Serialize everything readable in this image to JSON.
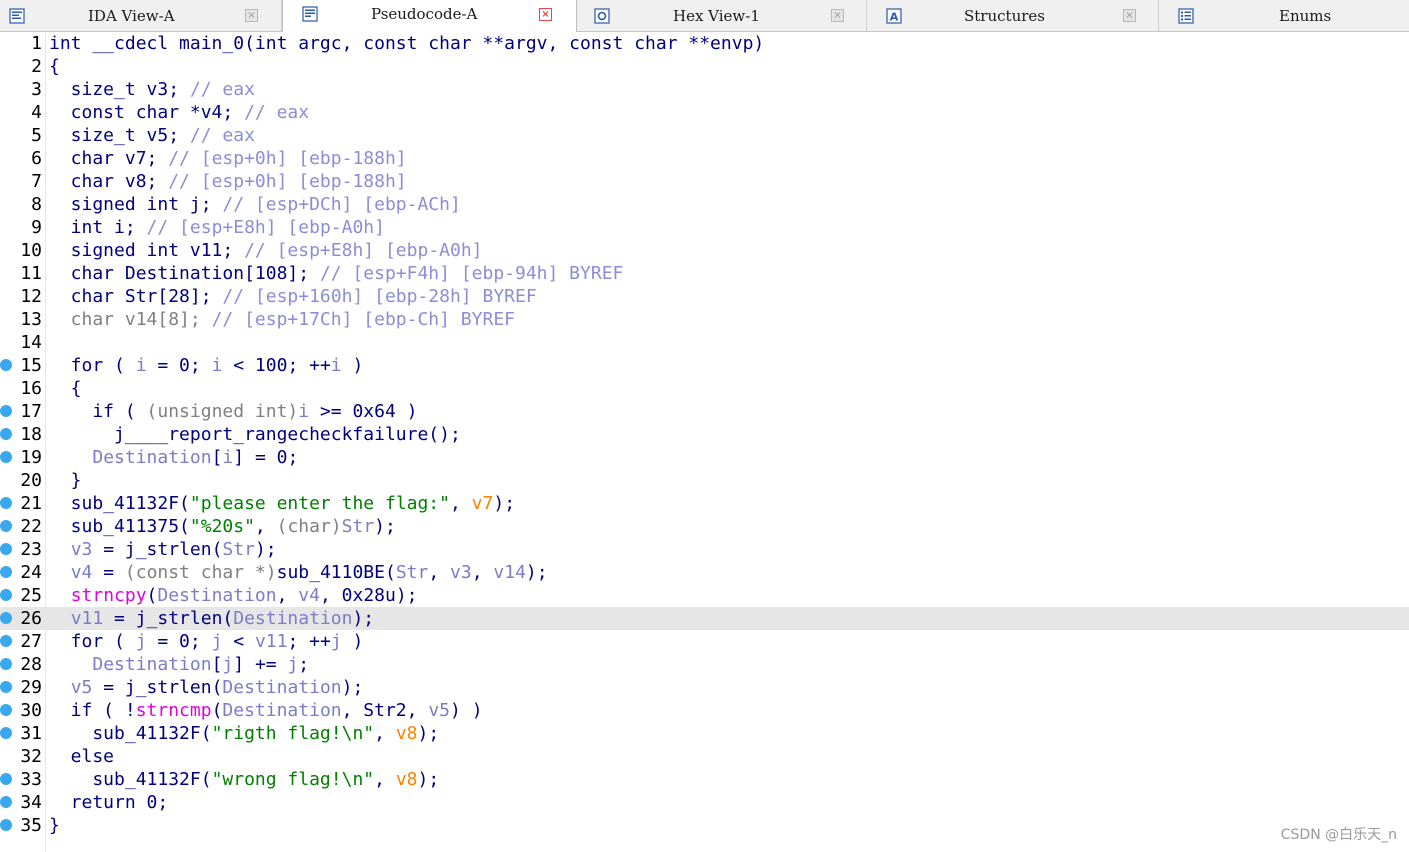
{
  "tabs": [
    {
      "label": "IDA View-A",
      "icon": "graph-view-icon",
      "active": false
    },
    {
      "label": "Pseudocode-A",
      "icon": "pseudocode-icon",
      "active": true
    },
    {
      "label": "Hex View-1",
      "icon": "hex-view-icon",
      "active": false
    },
    {
      "label": "Structures",
      "icon": "structures-icon",
      "active": false
    },
    {
      "label": "Enums",
      "icon": "enums-icon",
      "active": false
    }
  ],
  "close_glyph": "×",
  "current_line": 26,
  "breakpoint_lines": [
    15,
    17,
    18,
    19,
    21,
    22,
    23,
    24,
    25,
    26,
    27,
    28,
    29,
    30,
    31,
    33,
    34,
    35
  ],
  "code": [
    {
      "n": "1",
      "tokens": [
        [
          "ok",
          "int __cdecl main_0(int argc, const char **argv, const char **envp)"
        ]
      ]
    },
    {
      "n": "2",
      "tokens": [
        [
          "ok",
          "{"
        ]
      ]
    },
    {
      "n": "3",
      "tokens": [
        [
          "ok",
          "  size_t v3; "
        ],
        [
          "cm",
          "// eax"
        ]
      ]
    },
    {
      "n": "4",
      "tokens": [
        [
          "ok",
          "  const char *v4; "
        ],
        [
          "cm",
          "// eax"
        ]
      ]
    },
    {
      "n": "5",
      "tokens": [
        [
          "ok",
          "  size_t v5; "
        ],
        [
          "cm",
          "// eax"
        ]
      ]
    },
    {
      "n": "6",
      "tokens": [
        [
          "ok",
          "  char v7; "
        ],
        [
          "cm",
          "// [esp+0h] [ebp-188h]"
        ]
      ]
    },
    {
      "n": "7",
      "tokens": [
        [
          "ok",
          "  char v8; "
        ],
        [
          "cm",
          "// [esp+0h] [ebp-188h]"
        ]
      ]
    },
    {
      "n": "8",
      "tokens": [
        [
          "ok",
          "  signed int j; "
        ],
        [
          "cm",
          "// [esp+DCh] [ebp-ACh]"
        ]
      ]
    },
    {
      "n": "9",
      "tokens": [
        [
          "ok",
          "  int i; "
        ],
        [
          "cm",
          "// [esp+E8h] [ebp-A0h]"
        ]
      ]
    },
    {
      "n": "10",
      "tokens": [
        [
          "ok",
          "  signed int v11; "
        ],
        [
          "cm",
          "// [esp+E8h] [ebp-A0h]"
        ]
      ]
    },
    {
      "n": "11",
      "tokens": [
        [
          "ok",
          "  char Destination[108]; "
        ],
        [
          "cm",
          "// [esp+F4h] [ebp-94h] BYREF"
        ]
      ]
    },
    {
      "n": "12",
      "tokens": [
        [
          "ok",
          "  char Str[28]; "
        ],
        [
          "cm",
          "// [esp+160h] [ebp-28h] BYREF"
        ]
      ]
    },
    {
      "n": "13",
      "tokens": [
        [
          "gr",
          "  char v14[8]; "
        ],
        [
          "cm",
          "// [esp+17Ch] [ebp-Ch] BYREF"
        ]
      ]
    },
    {
      "n": "14",
      "tokens": [
        [
          "ok",
          ""
        ]
      ]
    },
    {
      "n": "15",
      "tokens": [
        [
          "ok",
          "  for ( "
        ],
        [
          "dv",
          "i"
        ],
        [
          "ok",
          " = 0; "
        ],
        [
          "dv",
          "i"
        ],
        [
          "ok",
          " < 100; ++"
        ],
        [
          "dv",
          "i"
        ],
        [
          "ok",
          " )"
        ]
      ]
    },
    {
      "n": "16",
      "tokens": [
        [
          "ok",
          "  {"
        ]
      ]
    },
    {
      "n": "17",
      "tokens": [
        [
          "ok",
          "    if ( "
        ],
        [
          "gr",
          "(unsigned int)"
        ],
        [
          "dv",
          "i"
        ],
        [
          "ok",
          " >= 0x64 )"
        ]
      ]
    },
    {
      "n": "18",
      "tokens": [
        [
          "ok",
          "      j____report_rangecheckfailure();"
        ]
      ]
    },
    {
      "n": "19",
      "tokens": [
        [
          "ok",
          "    "
        ],
        [
          "dv",
          "Destination"
        ],
        [
          "ok",
          "["
        ],
        [
          "dv",
          "i"
        ],
        [
          "ok",
          "] = 0;"
        ]
      ]
    },
    {
      "n": "20",
      "tokens": [
        [
          "ok",
          "  }"
        ]
      ]
    },
    {
      "n": "21",
      "tokens": [
        [
          "ok",
          "  sub_41132F("
        ],
        [
          "st",
          "\"please enter the flag:\""
        ],
        [
          "ok",
          ", "
        ],
        [
          "lc",
          "v7"
        ],
        [
          "ok",
          ");"
        ]
      ]
    },
    {
      "n": "22",
      "tokens": [
        [
          "ok",
          "  sub_411375("
        ],
        [
          "st",
          "\"%20s\""
        ],
        [
          "ok",
          ", "
        ],
        [
          "gr",
          "(char)"
        ],
        [
          "dv",
          "Str"
        ],
        [
          "ok",
          ");"
        ]
      ]
    },
    {
      "n": "23",
      "tokens": [
        [
          "ok",
          "  "
        ],
        [
          "dv",
          "v3"
        ],
        [
          "ok",
          " = j_strlen("
        ],
        [
          "dv",
          "Str"
        ],
        [
          "ok",
          ");"
        ]
      ]
    },
    {
      "n": "24",
      "tokens": [
        [
          "ok",
          "  "
        ],
        [
          "dv",
          "v4"
        ],
        [
          "ok",
          " = "
        ],
        [
          "gr",
          "(const char *)"
        ],
        [
          "ok",
          "sub_4110BE("
        ],
        [
          "dv",
          "Str"
        ],
        [
          "ok",
          ", "
        ],
        [
          "dv",
          "v3"
        ],
        [
          "ok",
          ", "
        ],
        [
          "dv",
          "v14"
        ],
        [
          "ok",
          ");"
        ]
      ]
    },
    {
      "n": "25",
      "tokens": [
        [
          "ok",
          "  "
        ],
        [
          "lf",
          "strncpy"
        ],
        [
          "ok",
          "("
        ],
        [
          "dv",
          "Destination"
        ],
        [
          "ok",
          ", "
        ],
        [
          "dv",
          "v4"
        ],
        [
          "ok",
          ", 0x28u);"
        ]
      ]
    },
    {
      "n": "26",
      "tokens": [
        [
          "ok",
          "  "
        ],
        [
          "dv",
          "v11"
        ],
        [
          "ok",
          " = j_strlen("
        ],
        [
          "dv",
          "Destination"
        ],
        [
          "ok",
          ");"
        ]
      ]
    },
    {
      "n": "27",
      "tokens": [
        [
          "ok",
          "  for ( "
        ],
        [
          "dv",
          "j"
        ],
        [
          "ok",
          " = 0; "
        ],
        [
          "dv",
          "j"
        ],
        [
          "ok",
          " < "
        ],
        [
          "dv",
          "v11"
        ],
        [
          "ok",
          "; ++"
        ],
        [
          "dv",
          "j"
        ],
        [
          "ok",
          " )"
        ]
      ]
    },
    {
      "n": "28",
      "tokens": [
        [
          "ok",
          "    "
        ],
        [
          "dv",
          "Destination"
        ],
        [
          "ok",
          "["
        ],
        [
          "dv",
          "j"
        ],
        [
          "ok",
          "] += "
        ],
        [
          "dv",
          "j"
        ],
        [
          "ok",
          ";"
        ]
      ]
    },
    {
      "n": "29",
      "tokens": [
        [
          "ok",
          "  "
        ],
        [
          "dv",
          "v5"
        ],
        [
          "ok",
          " = j_strlen("
        ],
        [
          "dv",
          "Destination"
        ],
        [
          "ok",
          ");"
        ]
      ]
    },
    {
      "n": "30",
      "tokens": [
        [
          "ok",
          "  if ( !"
        ],
        [
          "lf",
          "strncmp"
        ],
        [
          "ok",
          "("
        ],
        [
          "dv",
          "Destination"
        ],
        [
          "ok",
          ", Str2, "
        ],
        [
          "dv",
          "v5"
        ],
        [
          "ok",
          ") )"
        ]
      ]
    },
    {
      "n": "31",
      "tokens": [
        [
          "ok",
          "    sub_41132F("
        ],
        [
          "st",
          "\"rigth flag!\\n\""
        ],
        [
          "ok",
          ", "
        ],
        [
          "lc",
          "v8"
        ],
        [
          "ok",
          ");"
        ]
      ]
    },
    {
      "n": "32",
      "tokens": [
        [
          "ok",
          "  else"
        ]
      ]
    },
    {
      "n": "33",
      "tokens": [
        [
          "ok",
          "    sub_41132F("
        ],
        [
          "st",
          "\"wrong flag!\\n\""
        ],
        [
          "ok",
          ", "
        ],
        [
          "lc",
          "v8"
        ],
        [
          "ok",
          ");"
        ]
      ]
    },
    {
      "n": "34",
      "tokens": [
        [
          "ok",
          "  return 0;"
        ]
      ]
    },
    {
      "n": "35",
      "tokens": [
        [
          "ok",
          "}"
        ]
      ]
    }
  ],
  "watermark": "CSDN @白乐天_n",
  "colors": {
    "keyword_text": "#000080",
    "comment": "#8c8cd8",
    "string": "#008000",
    "library_function": "#e000e0",
    "local_var": "#ff8000",
    "dummy_var": "#7c7cc8",
    "breakpoint_dot": "#3aa8ee",
    "current_line_bg": "#e6e6e6"
  }
}
